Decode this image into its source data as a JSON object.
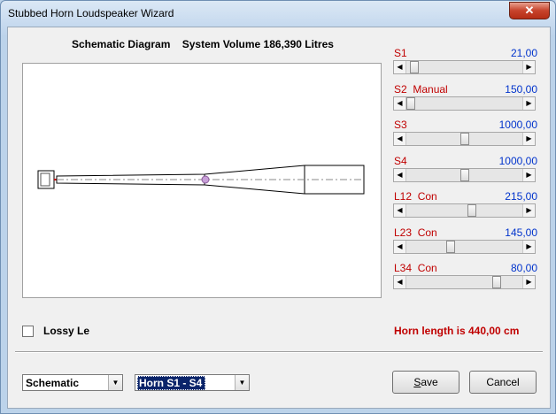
{
  "window": {
    "title": "Stubbed Horn Loudspeaker Wizard",
    "close_glyph": "✕"
  },
  "heading": {
    "label": "Schematic Diagram",
    "volume": "System Volume 186,390 Litres"
  },
  "sliders": [
    {
      "label": "S1",
      "value": "21,00",
      "position": 0.03
    },
    {
      "label": "S2  Manual",
      "value": "150,00",
      "position": 0.0
    },
    {
      "label": "S3",
      "value": "1000,00",
      "position": 0.5
    },
    {
      "label": "S4",
      "value": "1000,00",
      "position": 0.5
    },
    {
      "label": "L12  Con",
      "value": "215,00",
      "position": 0.57
    },
    {
      "label": "L23  Con",
      "value": "145,00",
      "position": 0.37
    },
    {
      "label": "L34  Con",
      "value": "80,00",
      "position": 0.8
    }
  ],
  "lossy": {
    "label": "Lossy Le",
    "checked": false
  },
  "horn_length": "Horn length is 440,00 cm",
  "view_combo": {
    "value": "Schematic"
  },
  "horn_combo": {
    "value": "Horn S1 - S4"
  },
  "buttons": {
    "save_prefix": "S",
    "save_rest": "ave",
    "cancel": "Cancel"
  },
  "colors": {
    "label_red": "#c00000",
    "value_blue": "#0033cc",
    "marker": "#c8a0d8"
  }
}
